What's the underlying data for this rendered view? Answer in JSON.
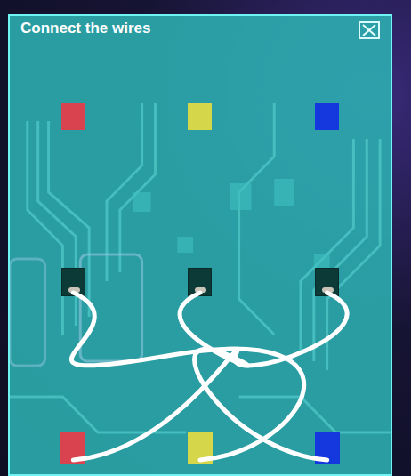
{
  "window": {
    "title": "Connect the wires"
  },
  "targets": [
    {
      "color": "#d8434f"
    },
    {
      "color": "#d6d64a"
    },
    {
      "color": "#1538de"
    }
  ],
  "sockets": [
    {
      "plugged": true
    },
    {
      "plugged": true
    },
    {
      "plugged": true
    }
  ],
  "sources": [
    {
      "color": "#d8434f"
    },
    {
      "color": "#d6d64a"
    },
    {
      "color": "#1538de"
    }
  ],
  "wires": [
    {
      "from": 0,
      "to": 1
    },
    {
      "from": 1,
      "to": 2
    },
    {
      "from": 2,
      "to": 0
    }
  ]
}
